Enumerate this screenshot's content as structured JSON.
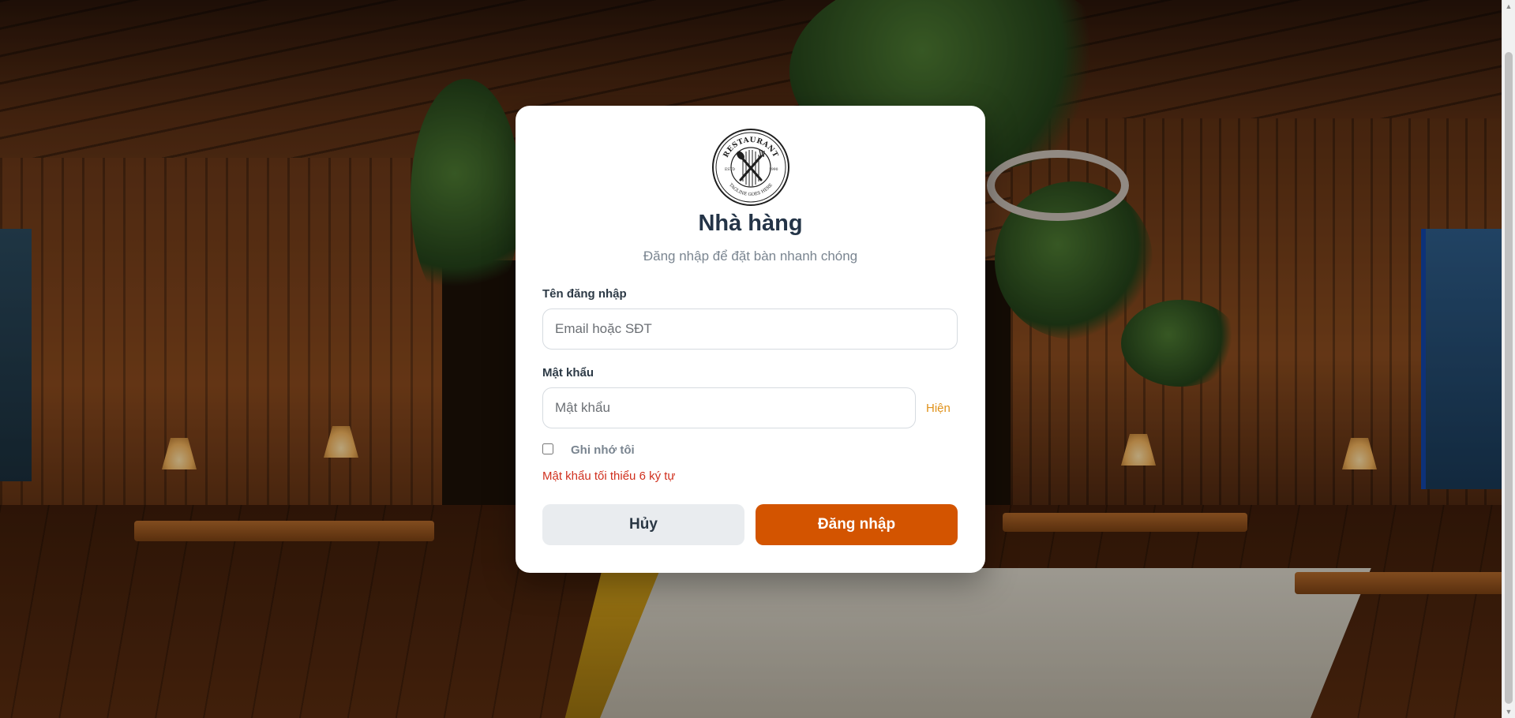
{
  "app": {
    "title": "Nhà hàng",
    "subtitle": "Đăng nhập để đặt bàn nhanh chóng"
  },
  "logo": {
    "top_text": "RESTAURANT",
    "bottom_text": "TAGLINE GOES HERE",
    "left_text": "ESTD",
    "right_text": "1990"
  },
  "form": {
    "username": {
      "label": "Tên đăng nhập",
      "placeholder": "Email hoặc SĐT",
      "value": ""
    },
    "password": {
      "label": "Mật khẩu",
      "placeholder": "Mật khẩu",
      "value": "",
      "toggle_label": "Hiện"
    },
    "remember": {
      "label": "Ghi nhớ tôi",
      "checked": false
    },
    "error": "Mật khẩu tối thiểu 6 ký tự"
  },
  "actions": {
    "cancel_label": "Hủy",
    "login_label": "Đăng nhập"
  },
  "colors": {
    "primary": "#d35400",
    "toggle": "#e0921b",
    "error": "#d0301e",
    "cancel_bg": "#e9ecef",
    "title": "#243447"
  },
  "icons": {
    "logo": "restaurant-fork-spoon-emblem"
  }
}
